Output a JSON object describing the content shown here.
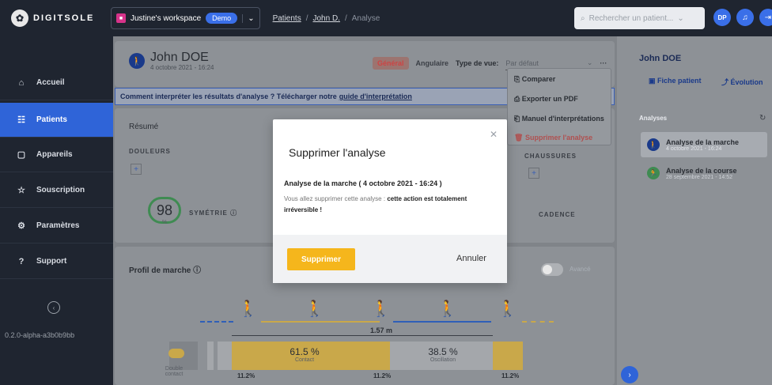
{
  "topbar": {
    "logo_text": "DIGITSOLE",
    "workspace_name": "Justine's workspace",
    "workspace_badge": "Demo",
    "breadcrumb": [
      "Patients",
      "/",
      "John D.",
      "/",
      "Analyse"
    ],
    "search_placeholder": "Rechercher un patient...",
    "avatar_initials": "DP"
  },
  "sidebar": {
    "items": [
      {
        "label": "Accueil",
        "icon": "home-icon"
      },
      {
        "label": "Patients",
        "icon": "patients-icon"
      },
      {
        "label": "Appareils",
        "icon": "devices-icon"
      },
      {
        "label": "Souscription",
        "icon": "subscription-icon"
      },
      {
        "label": "Paramètres",
        "icon": "settings-icon"
      },
      {
        "label": "Support",
        "icon": "support-icon"
      }
    ],
    "version": "0.2.0-alpha-a3b0b9bb"
  },
  "header": {
    "patient_name": "John DOE",
    "date": "4 octobre 2021 - 16:24",
    "tab_general": "Général",
    "tab_angulaire": "Angulaire",
    "view_type_label": "Type de vue:",
    "view_type_value": "Par défaut",
    "more": "···"
  },
  "banner": {
    "text": "Comment interpréter les résultats d'analyse ? Télécharger notre",
    "link": "guide d'interprétation"
  },
  "summary": {
    "title": "Résumé",
    "douleurs": "DOULEURS",
    "chaussures": "CHAUSSURES",
    "score": "98",
    "score_unit": "%",
    "symetrie": "SYMÉTRIE",
    "cadence": "CADENCE"
  },
  "profile": {
    "title": "Profil de marche",
    "advanced": "Avancé",
    "distance": "1.57 m",
    "contact_pct": "61.5 %",
    "contact_label": "Contact",
    "oscillation_pct": "38.5 %",
    "oscillation_label": "Oscillation",
    "double_contact": "Double contact",
    "small_pcts": [
      "11.2%",
      "11.2%",
      "11.2%"
    ]
  },
  "dropdown": {
    "items": [
      "Comparer",
      "Exporter un PDF",
      "Manuel d'interprétations",
      "Supprimer l'analyse"
    ]
  },
  "right_panel": {
    "name": "John DOE",
    "fiche_patient": "Fiche patient",
    "evolution": "Évolution",
    "analyses_title": "Analyses",
    "analyses": [
      {
        "title": "Analyse de la marche",
        "date": "4 octobre 2021 - 16:24"
      },
      {
        "title": "Analyse de la course",
        "date": "28 septembre 2021 - 14:52"
      }
    ]
  },
  "modal": {
    "title": "Supprimer l'analyse",
    "subtitle": "Analyse de la marche ( 4 octobre 2021 - 16:24 )",
    "body_prefix": "Vous allez supprimer cette analyse :",
    "body_bold": "cette action est totalement irréversible !",
    "delete_label": "Supprimer",
    "cancel_label": "Annuler"
  },
  "colors": {
    "accent_blue": "#2f64d8",
    "sidebar_bg": "#1f2530",
    "delete_yellow": "#f5b61c",
    "score_green": "#3f8b52"
  }
}
